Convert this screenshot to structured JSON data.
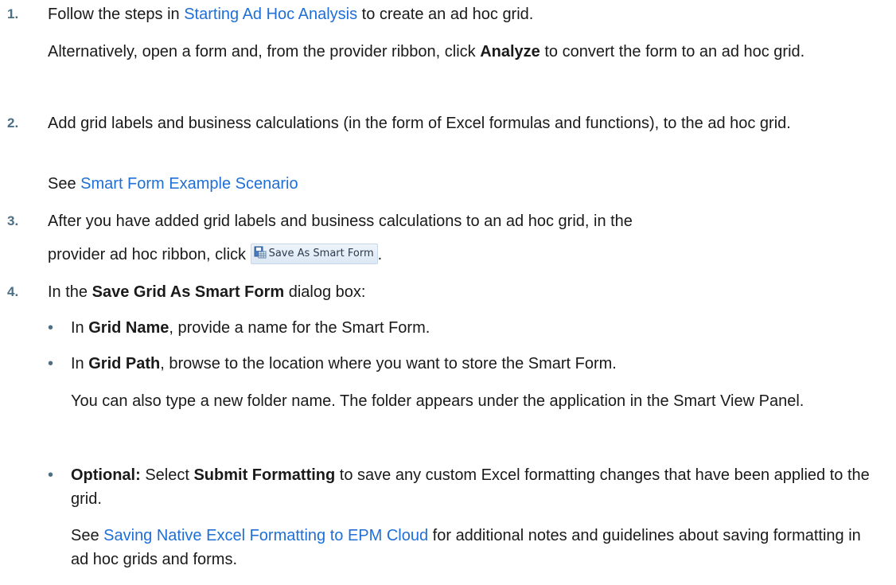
{
  "steps": [
    {
      "number": "1.",
      "pre": "Follow the steps in ",
      "link": "Starting Ad Hoc Analysis",
      "post": " to create an ad hoc grid.",
      "alt_pre": "Alternatively, open a form and, from the provider ribbon, click ",
      "alt_bold": "Analyze",
      "alt_post": " to convert the form to an ad hoc grid."
    },
    {
      "number": "2.",
      "text": "Add grid labels and business calculations (in the form of Excel formulas and functions), to the ad hoc grid.",
      "see_pre": "See ",
      "see_link": "Smart Form Example Scenario"
    },
    {
      "number": "3.",
      "line1": "After you have added grid labels and business calculations to an ad hoc grid, in the",
      "line2_pre": "provider ad hoc ribbon, click ",
      "button_label": "Save As Smart Form",
      "button_icon": "save-as-smart-form-icon",
      "line2_post": "."
    },
    {
      "number": "4.",
      "pre": "In the ",
      "bold": "Save Grid As Smart Form",
      "post": " dialog box:",
      "bullets": [
        {
          "pre": "In ",
          "bold": "Grid Name",
          "post": ", provide a name for the Smart Form."
        },
        {
          "pre": "In ",
          "bold": "Grid Path",
          "post": ", browse to the location where you want to store the Smart Form.",
          "note": "You can also type a new folder name. The folder appears under the application in the Smart View Panel."
        },
        {
          "bold_pre": "Optional:",
          "mid": " Select ",
          "bold": "Submit Formatting",
          "post": " to save any custom Excel formatting changes that have been applied to the grid.",
          "see_pre": "See ",
          "see_link": "Saving Native Excel Formatting to EPM Cloud",
          "see_post": " for additional notes and guidelines about saving formatting in ad hoc grids and forms."
        }
      ]
    }
  ]
}
